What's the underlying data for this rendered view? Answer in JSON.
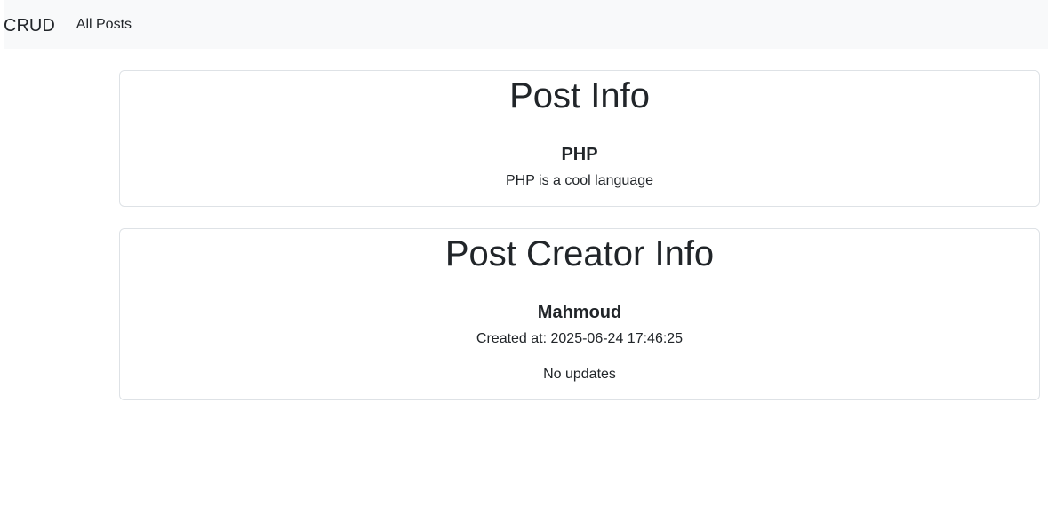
{
  "navbar": {
    "brand": "CRUD",
    "links": [
      "All Posts"
    ]
  },
  "post_info": {
    "heading": "Post Info",
    "title": "PHP",
    "description": "PHP is a cool language"
  },
  "creator_info": {
    "heading": "Post Creator Info",
    "name": "Mahmoud",
    "created_at": "Created at: 2025-06-24 17:46:25",
    "updated": "No updates"
  },
  "colors": {
    "navbar_bg": "#f8f9fa",
    "text": "#212529",
    "card_border": "#dee2e6"
  }
}
